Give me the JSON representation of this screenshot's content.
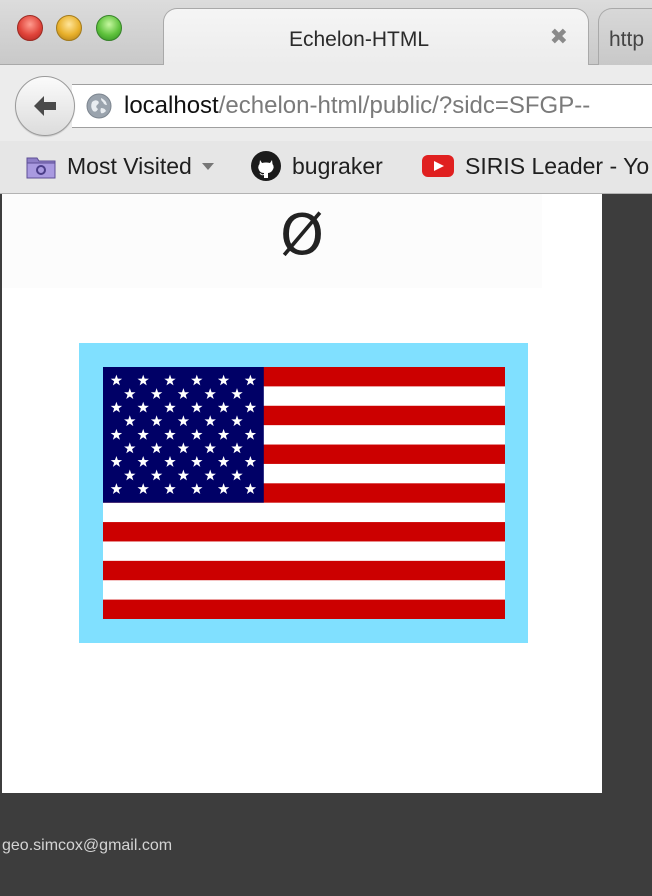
{
  "window": {
    "tabs": [
      {
        "title": "Echelon-HTML",
        "close": "✖"
      },
      {
        "title": "http"
      }
    ]
  },
  "navigation": {
    "url_host": "localhost",
    "url_path": "/echelon-html/public/?sidc=SFGP--"
  },
  "bookmarks": [
    {
      "label": "Most Visited",
      "icon": "folder-icon",
      "has_dropdown": true
    },
    {
      "label": "bugraker",
      "icon": "github-icon"
    },
    {
      "label": "SIRIS Leader - Yo",
      "icon": "youtube-icon"
    }
  ],
  "page": {
    "symbol_title": "Ø",
    "symbol_frame_color": "#80e0ff",
    "flag": {
      "stripe_red": "#cc0000",
      "stripe_white": "#ffffff",
      "canton_blue": "#000066",
      "stripe_count": 13,
      "star_count": 50
    },
    "footer_email": "geo.simcox@gmail.com"
  }
}
